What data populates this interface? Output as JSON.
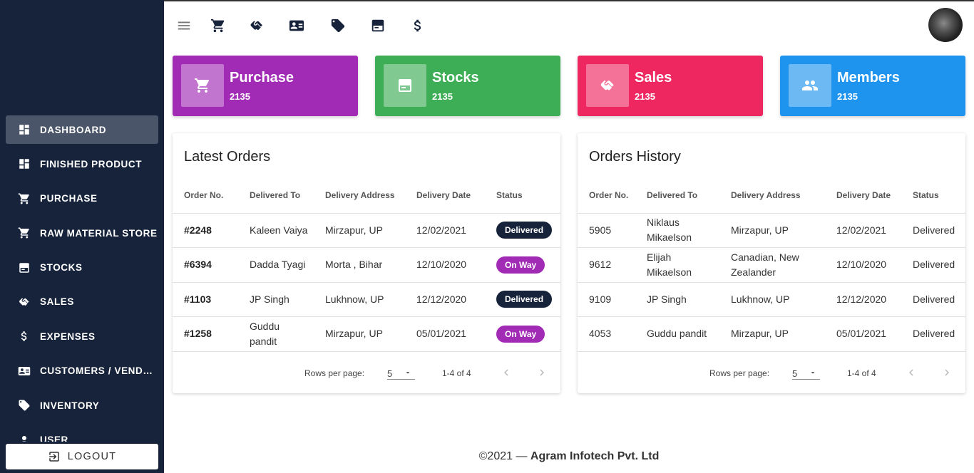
{
  "sidebar": {
    "items": [
      {
        "label": "DASHBOARD",
        "icon": "dashboard-icon",
        "active": true
      },
      {
        "label": "FINISHED PRODUCT",
        "icon": "dashboard-icon"
      },
      {
        "label": "PURCHASE",
        "icon": "cart-icon"
      },
      {
        "label": "RAW MATERIAL STORE",
        "icon": "cart-icon"
      },
      {
        "label": "STOCKS",
        "icon": "box-icon"
      },
      {
        "label": "SALES",
        "icon": "handshake-icon"
      },
      {
        "label": "EXPENSES",
        "icon": "dollar-icon"
      },
      {
        "label": "CUSTOMERS / VENDO...",
        "icon": "contact-card-icon"
      },
      {
        "label": "INVENTORY",
        "icon": "tag-icon"
      },
      {
        "label": "USER",
        "icon": "user-icon"
      }
    ],
    "logout_label": "LOGOUT"
  },
  "topbar": {
    "icons": [
      "menu-icon",
      "cart-icon",
      "handshake-icon",
      "contact-card-icon",
      "tag-icon",
      "box-icon",
      "dollar-icon"
    ]
  },
  "stats": [
    {
      "title": "Purchase",
      "value": "2135",
      "color": "#a12bb5",
      "icon": "cart-icon"
    },
    {
      "title": "Stocks",
      "value": "2135",
      "color": "#3dae56",
      "icon": "box-icon"
    },
    {
      "title": "Sales",
      "value": "2135",
      "color": "#ef2761",
      "icon": "handshake-icon"
    },
    {
      "title": "Members",
      "value": "2135",
      "color": "#1e94ee",
      "icon": "group-icon"
    }
  ],
  "latest_orders": {
    "title": "Latest Orders",
    "columns": [
      "Order No.",
      "Delivered To",
      "Delivery Address",
      "Delivery Date",
      "Status"
    ],
    "rows": [
      {
        "order": "#2248",
        "to": "Kaleen Vaiya",
        "address": "Mirzapur, UP",
        "date": "12/02/2021",
        "status": "Delivered"
      },
      {
        "order": "#6394",
        "to": "Dadda Tyagi",
        "address": "Morta , Bihar",
        "date": "12/10/2020",
        "status": "On Way"
      },
      {
        "order": "#1103",
        "to": "JP Singh",
        "address": "Lukhnow, UP",
        "date": "12/12/2020",
        "status": "Delivered"
      },
      {
        "order": "#1258",
        "to": "Guddu pandit",
        "address": "Mirzapur, UP",
        "date": "05/01/2021",
        "status": "On Way"
      }
    ],
    "status_colors": {
      "Delivered": "#16233a",
      "On Way": "#a12bb5"
    },
    "pager": {
      "rows_label": "Rows per page:",
      "rows_value": "5",
      "range": "1-4 of 4"
    }
  },
  "orders_history": {
    "title": "Orders History",
    "columns": [
      "Order No.",
      "Delivered To",
      "Delivery Address",
      "Delivery Date",
      "Status"
    ],
    "rows": [
      {
        "order": "5905",
        "to": "Niklaus Mikaelson",
        "address": "Mirzapur, UP",
        "date": "12/02/2021",
        "status": "Delivered"
      },
      {
        "order": "9612",
        "to": "Elijah Mikaelson",
        "address": "Canadian, New Zealander",
        "date": "12/10/2020",
        "status": "Delivered"
      },
      {
        "order": "9109",
        "to": "JP Singh",
        "address": "Lukhnow, UP",
        "date": "12/12/2020",
        "status": "Delivered"
      },
      {
        "order": "4053",
        "to": "Guddu pandit",
        "address": "Mirzapur, UP",
        "date": "05/01/2021",
        "status": "Delivered"
      }
    ],
    "pager": {
      "rows_label": "Rows per page:",
      "rows_value": "5",
      "range": "1-4 of 4"
    }
  },
  "footer": {
    "copyright": "©2021 —",
    "company": "Agram Infotech Pvt. Ltd"
  }
}
